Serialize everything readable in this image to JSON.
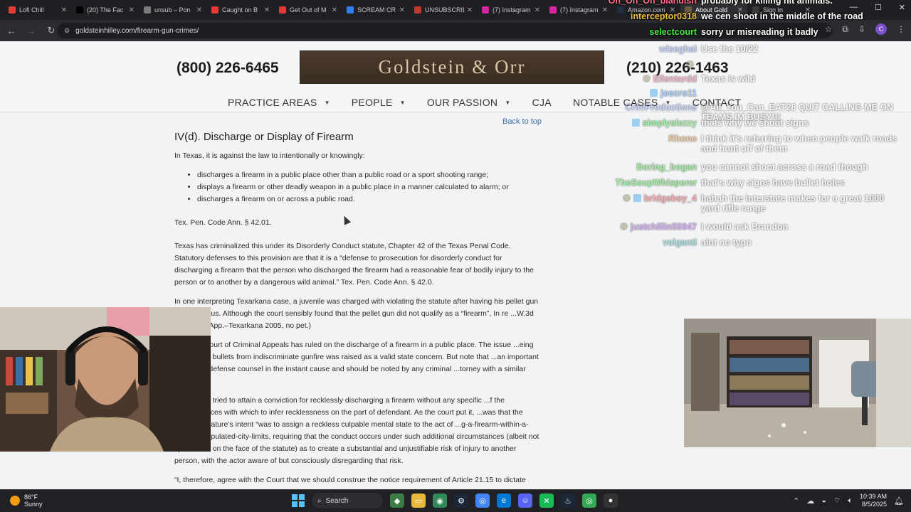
{
  "browser": {
    "tabs": [
      {
        "title": "Lofi Chill",
        "color": "#e53935",
        "active": false
      },
      {
        "title": "(20) The Fac",
        "color": "#000000",
        "active": false
      },
      {
        "title": "unsub – Pon",
        "color": "#7a7a7a",
        "active": false
      },
      {
        "title": "Caught on B",
        "color": "#e53935",
        "active": false
      },
      {
        "title": "Get Out of M",
        "color": "#e53935",
        "active": false
      },
      {
        "title": "SCREAM CR",
        "color": "#2f80ed",
        "active": false
      },
      {
        "title": "UNSUBSCRIB",
        "color": "#c0392b",
        "active": false
      },
      {
        "title": "(7) Instagram",
        "color": "#d6249f",
        "active": false
      },
      {
        "title": "(7) Instagram",
        "color": "#d6249f",
        "active": false
      },
      {
        "title": "Amazon.com",
        "color": "#232f3e",
        "active": false
      },
      {
        "title": "About Gold",
        "color": "#6b5a40",
        "active": true
      },
      {
        "title": "Sign In",
        "color": "#3a3a3a",
        "active": false
      }
    ],
    "url": "goldsteinhilley.com/firearm-gun-crimes/",
    "profile_initial": "C"
  },
  "site": {
    "phone_left": "(800) 226-6465",
    "logo": "Goldstein & Orr",
    "phone_right": "(210) 226-1463",
    "nav": [
      "PRACTICE AREAS",
      "PEOPLE",
      "OUR PASSION",
      "CJA",
      "NOTABLE CASES",
      "CONTACT"
    ],
    "nav_has_caret": [
      true,
      true,
      true,
      false,
      true,
      false
    ],
    "back_to_top": "Back to top",
    "heading": "IV(d). Discharge or Display of Firearm",
    "intro": "In Texas, it is against the law to intentionally or knowingly:",
    "bullets": [
      "discharges a firearm in a public place other than a public road or a sport shooting range;",
      "displays a firearm or other deadly weapon in a public place in a manner calculated to alarm; or",
      "discharges a firearm on or across a public road."
    ],
    "citation": "Tex. Pen. Code Ann. § 42.01.",
    "para1": "Texas has criminalized this under its Disorderly Conduct statute, Chapter 42 of the Texas Penal Code. Statutory defenses to this provision are that it is a “defense to prosecution for disorderly conduct for discharging a firearm that the person who discharged the firearm had a reasonable fear of bodily injury to the person or to another by a dangerous wild animal.” Tex. Pen. Code Ann. § 42.0.",
    "para2": "In one interpreting Texarkana case, a juvenile was charged with violating the statute after having his pellet gun ...ool campus. Although the court sensibly found that the pellet gun did not qualify as a “firearm”, In re ...W.3d 459, (Tex. App.–Texarkana 2005, no pet.)",
    "para3": "...tly, the Court of Criminal Appeals has ruled on the discharge of a firearm in a public place. The issue ...eing hit by stray bullets from indiscriminate gunfire was raised as a valid state concern. But note that ...an important victory for defense counsel in the instant cause and should be noted by any criminal ...torney with a similar case.",
    "para4": "...the State tried to attain a conviction for recklessly discharging a firearm without any specific ...f the circumstances with which to infer recklessness on the part of defendant. As the court put it, ...was that the State legislature’s intent “was to assign a reckless culpable mental state to the act of ...g-a-firearm-within-a- densely-populated-city-limits, requiring that the conduct occurs under such additional circumstances (albeit not spelled out on the face of the statute) as to create a substantial and unjustifiable risk of injury to another person, with the actor aware of but consciously disregarding that risk.",
    "para5": "“I, therefore, agree with the Court that we should construe the notice requirement of Article 21.15 to dictate"
  },
  "chat": [
    {
      "user": "Oh_Oh_Oh_blandish",
      "text": "probably for killing hit animals.",
      "color": "#ff6b8a",
      "faded": false,
      "badge": ""
    },
    {
      "user": "interceptor0318",
      "text": "we cen shoot in the middle of the road",
      "color": "#f0c040",
      "faded": false,
      "badge": ""
    },
    {
      "user": "selectcourt",
      "text": "sorry ur misreading it badly",
      "color": "#3cf03c",
      "faded": false,
      "badge": ""
    },
    {
      "user": "wiseghai",
      "text": "Use the 10/22",
      "color": "#8ab4ff",
      "faded": true,
      "badge": ""
    },
    {
      "user": "",
      "text": "",
      "color": "#ff4040",
      "faded": true,
      "badge": "shield"
    },
    {
      "user": "Ellentardd",
      "text": "Texas is wild",
      "color": "#ff6b8a",
      "faded": true,
      "badge": "shield"
    },
    {
      "user": "joecro11",
      "text": "",
      "color": "#4fa3ff",
      "faded": true,
      "badge": "sub"
    },
    {
      "user": "CrlivProductions",
      "text": "@All_You_Can_EAT28 QUIT CALLING ME ON TEAMS IM BUSY!!!",
      "color": "#9ab0ff",
      "faded": true,
      "badge": ""
    },
    {
      "user": "simplyslezzy",
      "text": "thats why we shoot signs",
      "color": "#3cf03c",
      "faded": true,
      "badge": "sub"
    },
    {
      "user": "Rhono",
      "text": "I think it's referring to when people walk roads and hunt off of them",
      "color": "#ff9c40",
      "faded": true,
      "badge": ""
    },
    {
      "user": "Boring_bogan",
      "text": "you cannot shoot across a road though",
      "color": "#3cf03c",
      "faded": true,
      "badge": ""
    },
    {
      "user": "TheSoupWhisperer",
      "text": "that's why signs have bullet holes",
      "color": "#3cf03c",
      "faded": true,
      "badge": ""
    },
    {
      "user": "bridgeboy_4",
      "text": "hahah the interstate makes for a great 1000 yard rifle range",
      "color": "#ff5a5a",
      "faded": true,
      "badge": "both"
    },
    {
      "user": "justchillin55947",
      "text": "I would ask Brandon",
      "color": "#b85cff",
      "faded": true,
      "badge": "shield"
    },
    {
      "user": "volganti",
      "text": "aint no typo",
      "color": "#4dd0c8",
      "faded": true,
      "badge": ""
    }
  ],
  "taskbar": {
    "temp": "86°F",
    "weather": "Sunny",
    "search": "Search",
    "time": "10:39 AM",
    "date": "8/5/2025"
  }
}
